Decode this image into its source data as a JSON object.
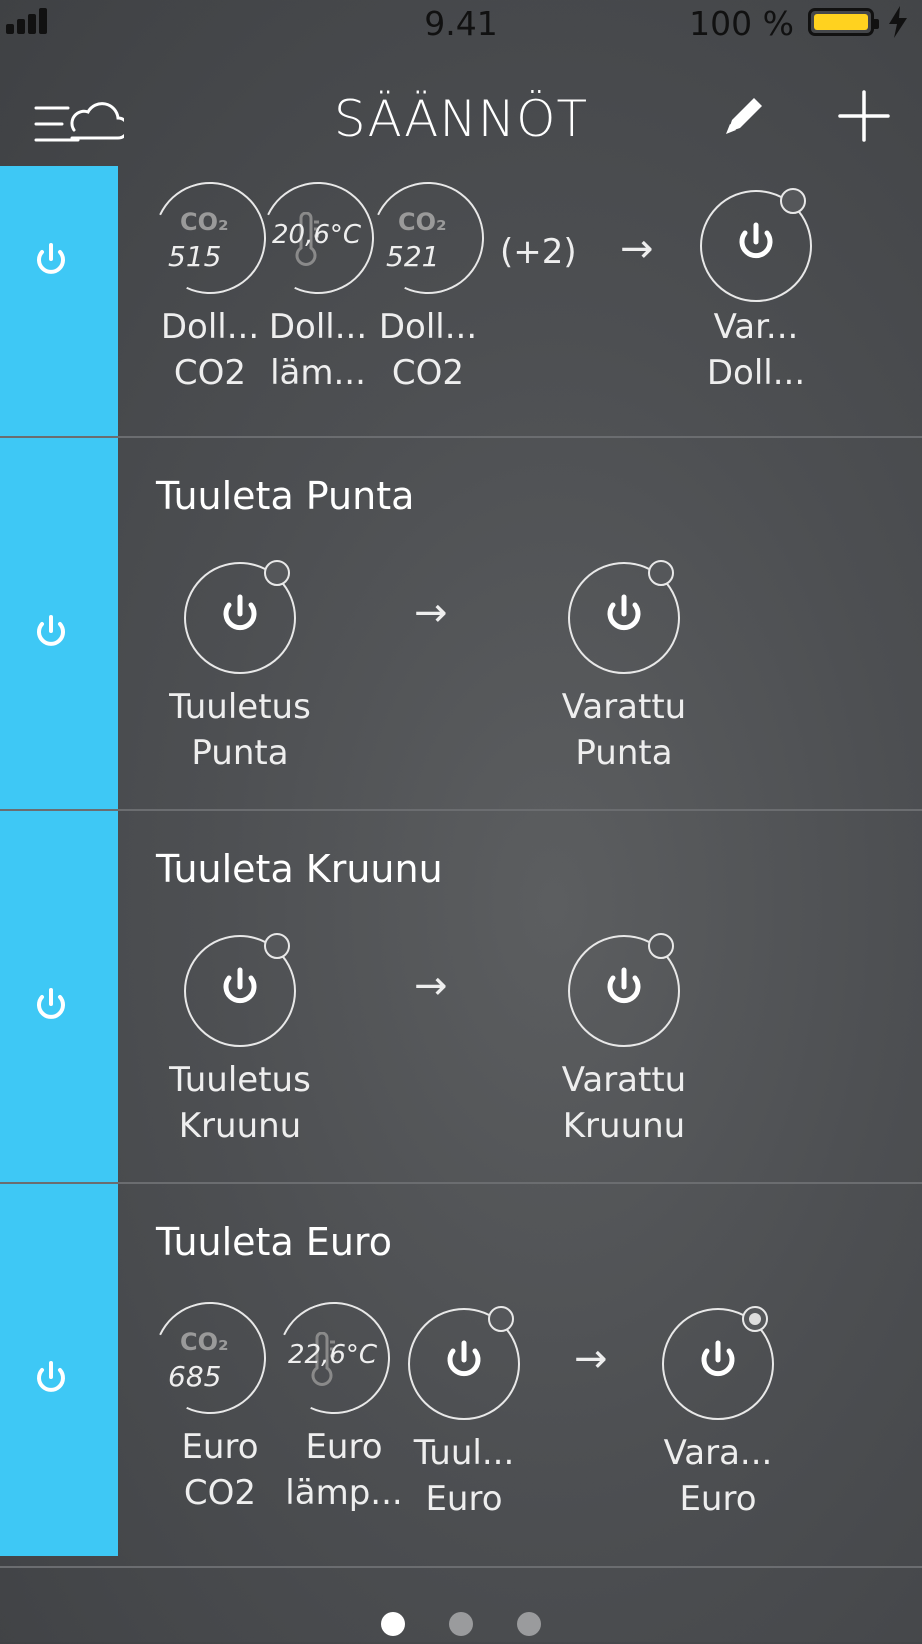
{
  "status": {
    "time": "9.41",
    "battery": "100 %",
    "battery_color": "#ffd21f",
    "battery_level": 1.0
  },
  "nav": {
    "title": "SÄÄNNÖT",
    "menu_icon": "menu-weather-icon",
    "edit_icon": "pencil-icon",
    "add_icon": "plus-icon"
  },
  "accent": "#3ec8f5",
  "rules": [
    {
      "title": "",
      "conditions": [
        {
          "type": "co2",
          "badge": "CO₂",
          "value": "515",
          "label1": "Doll...",
          "label2": "CO2"
        },
        {
          "type": "temp",
          "value": "20,6°C",
          "label1": "Doll...",
          "label2": "läm..."
        },
        {
          "type": "co2",
          "badge": "CO₂",
          "value": "521",
          "label1": "Doll...",
          "label2": "CO2"
        }
      ],
      "more": "(+2)",
      "arrow": "→",
      "action": {
        "label1": "Var...",
        "label2": "Doll..."
      }
    },
    {
      "title": "Tuuleta Punta",
      "conditions": [
        {
          "type": "switch",
          "label1": "Tuuletus",
          "label2": "Punta"
        }
      ],
      "arrow": "→",
      "action": {
        "label1": "Varattu",
        "label2": "Punta"
      }
    },
    {
      "title": "Tuuleta Kruunu",
      "conditions": [
        {
          "type": "switch",
          "label1": "Tuuletus",
          "label2": "Kruunu"
        }
      ],
      "arrow": "→",
      "action": {
        "label1": "Varattu",
        "label2": "Kruunu"
      }
    },
    {
      "title": "Tuuleta Euro",
      "conditions": [
        {
          "type": "co2",
          "badge": "CO₂",
          "value": "685",
          "label1": "Euro",
          "label2": "CO2"
        },
        {
          "type": "temp",
          "value": "22,6°C",
          "label1": "Euro",
          "label2": "lämp..."
        },
        {
          "type": "switch",
          "label1": "Tuul...",
          "label2": "Euro"
        }
      ],
      "arrow": "→",
      "action": {
        "label1": "Vara...",
        "label2": "Euro",
        "active": true
      }
    }
  ],
  "pager": {
    "pages": 3,
    "current": 1
  }
}
